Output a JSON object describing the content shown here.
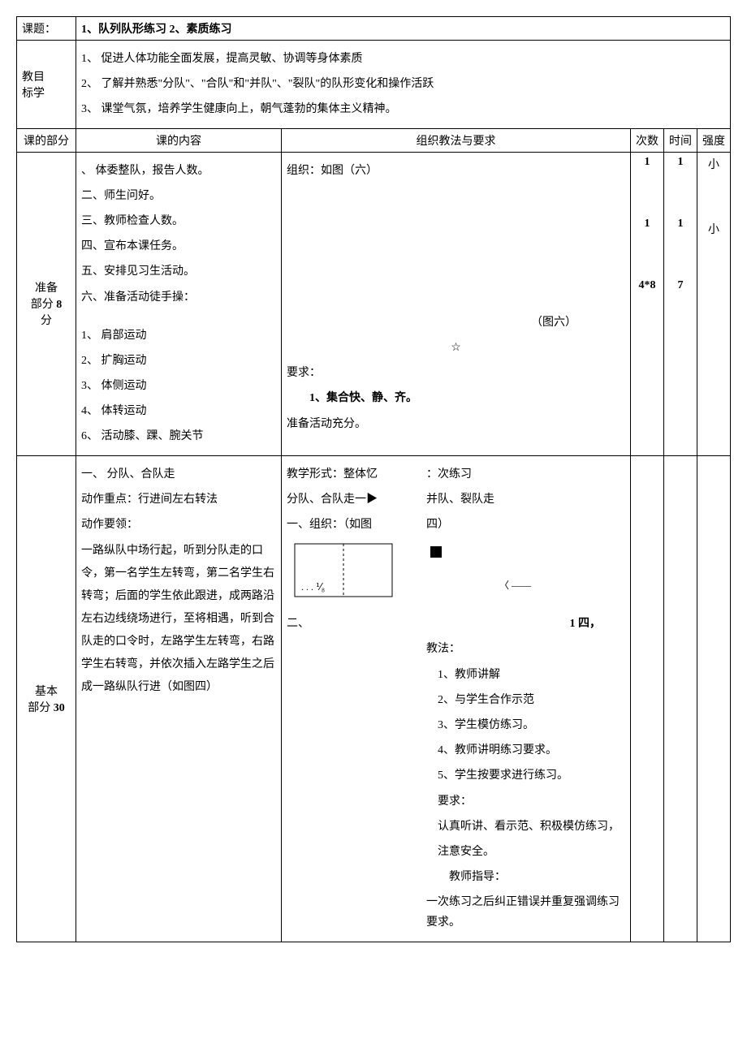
{
  "header": {
    "topic_label": "课题：",
    "topic_value": "1、队列队形练习 2、素质练习",
    "goal_label": "教目\n标学",
    "goals": [
      "1、   促进人体功能全面发展，提高灵敏、协调等身体素质",
      "2、   了解并熟悉\"分队\"、\"合队\"和\"并队\"、\"裂队\"的队形变化和操作活跃",
      "3、   课堂气氛，培养学生健康向上，朝气蓬勃的集体主义精神。"
    ]
  },
  "table_head": {
    "part": "课的部分",
    "content": "课的内容",
    "method": "组织教法与要求",
    "count": "次数",
    "time": "时间",
    "intensity": "强度"
  },
  "prep": {
    "part_label": "准备部分 8分",
    "content_lines": [
      "、   体委整队，报告人数。",
      "二、师生问好。",
      "三、教师检查人数。",
      "四、宣布本课任务。",
      "五、安排见习生活动。",
      "六、准备活动徒手操："
    ],
    "exercises": [
      "1、   肩部运动",
      "2、   扩胸运动",
      "3、   体侧运动",
      "4、   体转运动",
      "6、   活动膝、踝、腕关节"
    ],
    "method_top": "组织：如图（六）",
    "figure_label": "（图六）",
    "star": "☆",
    "require_label": "要求：",
    "require_line": "1、集合快、静、齐。",
    "require_end": "准备活动充分。",
    "counts": [
      "1",
      "1",
      "4*8"
    ],
    "times": [
      "1",
      "1",
      "7"
    ],
    "intensities": [
      "小",
      "小"
    ]
  },
  "basic": {
    "part_label": "基本部分 30",
    "content": {
      "title": "一、      分队、合队走",
      "key_label": "动作重点：行进间左右转法",
      "essentials_label": "动作要领：",
      "paragraph": "   一路纵队中场行起，听到分队走的口令，第一名学生左转弯，第二名学生右转弯；后面的学生依此跟进，成两路沿左右边线绕场进行，至将相遇，听到合队走的口令时，左路学生左转弯，右路学生右转弯，并依次插入左路学生之后成一路纵队行进（如图四）"
    },
    "method": {
      "form_line": "教学形式：整体忆",
      "form_right_a": "：次练习",
      "split_line": "分队、合队走一▶",
      "split_right": "并队、裂队走",
      "org_line": "一、组织：（如图",
      "org_right": "四）",
      "fig_end": "1 四，",
      "teach_label": "二、",
      "teach_label2": "教法：",
      "teach_items": [
        "1、教师讲解",
        "2、与学生合作示范",
        "3、学生模仿练习。",
        "4、教师讲明练习要求。",
        "5、学生按要求进行练习。"
      ],
      "require_label": "要求：",
      "require_lines": [
        "认真听讲、看示范、积极模仿练习，",
        "注意安全。"
      ],
      "guide_label": "教师指导：",
      "guide_line": "一次练习之后纠正错误并重复强调练习要求。"
    }
  }
}
